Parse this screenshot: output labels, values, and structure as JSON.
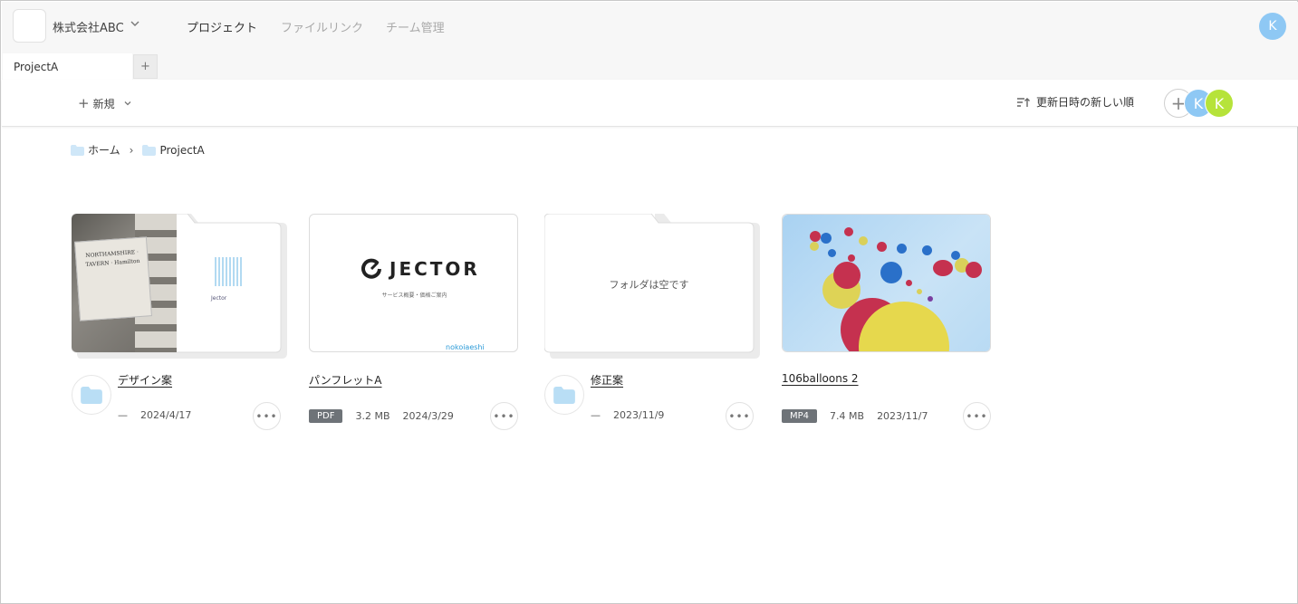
{
  "header": {
    "org_name": "株式会社ABC",
    "nav": [
      "プロジェクト",
      "ファイルリンク",
      "チーム管理"
    ],
    "user_initial": "K"
  },
  "tabs": {
    "active": "ProjectA",
    "add_label": "+"
  },
  "toolbar": {
    "new_label": "新規",
    "sort_label": "更新日時の新しい順",
    "add_member": "+",
    "members": [
      "K",
      "K"
    ]
  },
  "breadcrumb": {
    "home": "ホーム",
    "current": "ProjectA"
  },
  "cards": [
    {
      "name": "デザイン案",
      "kind": "folder",
      "meta_dash": "—",
      "date": "2024/4/17",
      "sign_text": "NORTHAMSHIRE · TAVERN · Hamilton",
      "brand": "Jector"
    },
    {
      "name": "パンフレットA",
      "kind": "file",
      "type": "PDF",
      "size": "3.2 MB",
      "date": "2024/3/29",
      "logo_word": "JECTOR",
      "sub": "サービス概要・価格ご案内",
      "foot": "nokoiaeshi"
    },
    {
      "name": "修正案",
      "kind": "folder",
      "meta_dash": "—",
      "date": "2023/11/9",
      "empty_text": "フォルダは空です"
    },
    {
      "name": "106balloons 2",
      "kind": "file",
      "type": "MP4",
      "size": "7.4 MB",
      "date": "2023/11/7"
    }
  ],
  "colors": {
    "accent_avatar": "#8ec8f4",
    "avatar_green": "#b6e33a",
    "badge_bg": "#6e7378",
    "folder_icon": "#b9def5"
  }
}
